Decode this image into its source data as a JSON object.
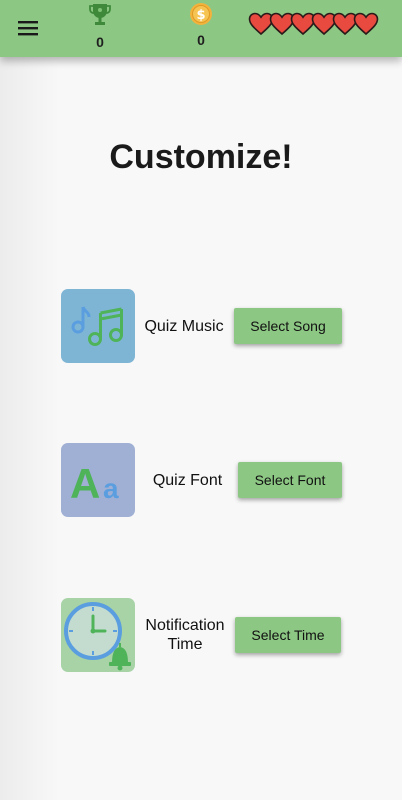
{
  "header": {
    "menu_icon": "hamburger-menu-icon",
    "trophy": {
      "icon": "trophy-icon",
      "value": "0",
      "color": "#3f8a3a"
    },
    "coins": {
      "icon": "coin-icon",
      "value": "0",
      "color": "#f2b33d"
    },
    "lives": {
      "icon": "heart-icon",
      "count": 6,
      "color": "#e84a3f"
    },
    "background_color": "#8dc784"
  },
  "page": {
    "title": "Customize!"
  },
  "options": [
    {
      "icon": "music-notes-icon",
      "label": "Quiz Music",
      "button_label": "Select Song",
      "tile_color": "#7fb5d4"
    },
    {
      "icon": "font-aa-icon",
      "label": "Quiz Font",
      "button_label": "Select Font",
      "tile_color": "#9fb0d4"
    },
    {
      "icon": "clock-bell-icon",
      "label_line1": "Notification",
      "label_line2": "Time",
      "button_label": "Select Time",
      "tile_color": "#a7d3a6"
    }
  ],
  "colors": {
    "accent_green": "#8dc784",
    "icon_green": "#4fb35a",
    "icon_blue": "#5a9ee0"
  }
}
